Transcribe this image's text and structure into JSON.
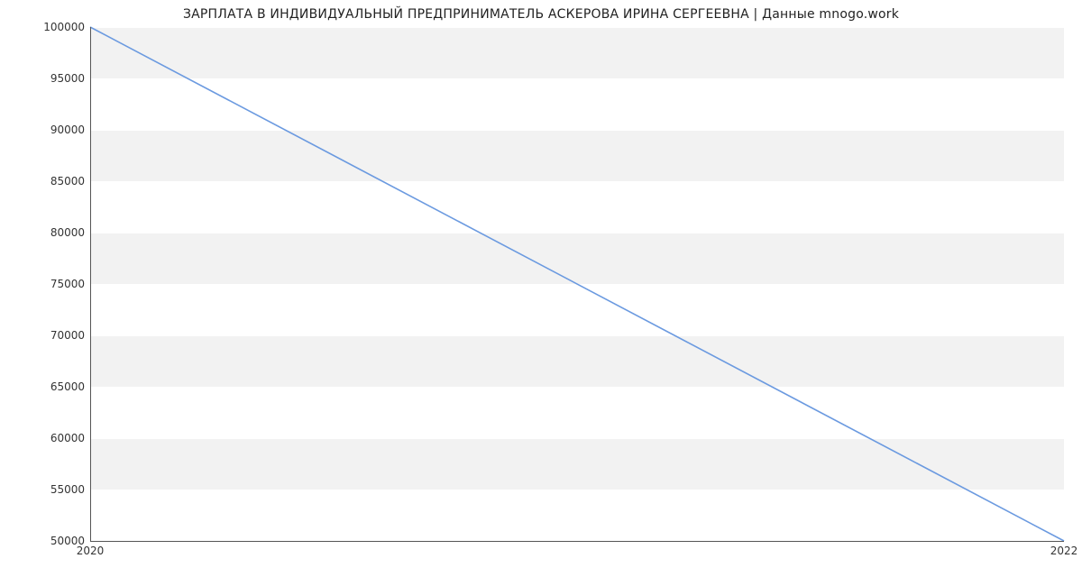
{
  "chart_data": {
    "type": "line",
    "title": "ЗАРПЛАТА В ИНДИВИДУАЛЬНЫЙ ПРЕДПРИНИМАТЕЛЬ АСКЕРОВА ИРИНА СЕРГЕЕВНА | Данные mnogo.work",
    "xlabel": "",
    "ylabel": "",
    "x": [
      2020,
      2022
    ],
    "series": [
      {
        "name": "salary",
        "values": [
          100000,
          50000
        ],
        "color": "#6b9ae0"
      }
    ],
    "xlim": [
      2020,
      2022
    ],
    "ylim": [
      50000,
      100000
    ],
    "yticks": [
      50000,
      55000,
      60000,
      65000,
      70000,
      75000,
      80000,
      85000,
      90000,
      95000,
      100000
    ],
    "xticks": [
      2020,
      2022
    ],
    "grid": true
  }
}
